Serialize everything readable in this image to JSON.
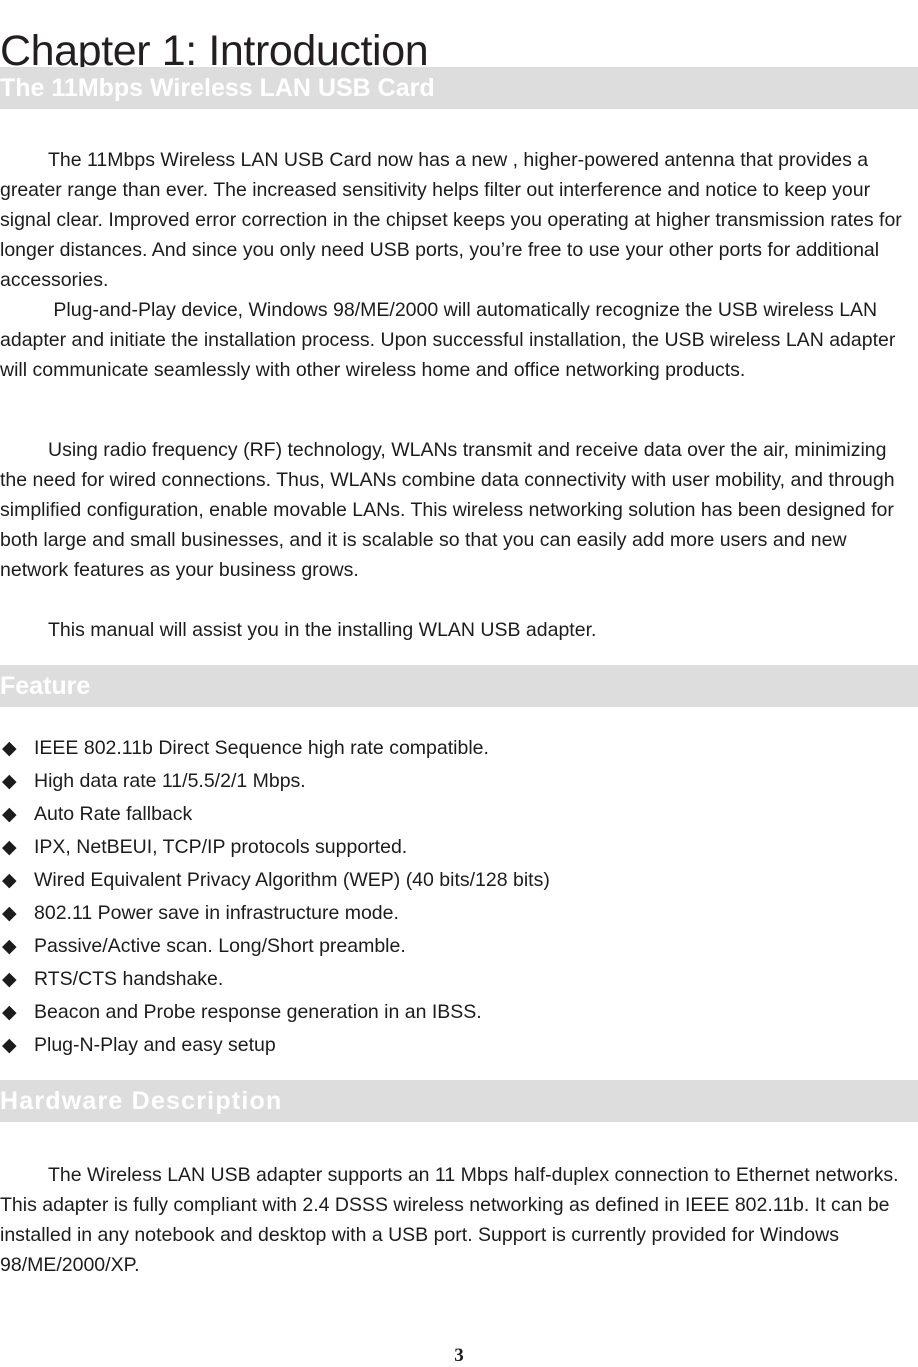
{
  "document": {
    "chapter_title": "Chapter 1: Introduction",
    "page_number": "3",
    "band_color": "#dddddd",
    "band_text_color": "#ffffff",
    "body_text_color": "#1c1c1c"
  },
  "sections": {
    "card": {
      "heading": "The 11Mbps Wireless LAN USB Card",
      "paragraphs": [
        "The 11Mbps Wireless LAN USB Card now has a new , higher-powered antenna that provides a greater range than ever. The increased sensitivity helps filter out interference and notice to keep your signal clear. Improved error correction in the chipset keeps you operating at higher transmission rates for longer distances. And since you only need USB ports, you’re free to use your other ports for additional accessories.",
        " Plug-and-Play device, Windows 98/ME/2000 will automatically recognize the USB wireless LAN adapter and initiate the installation process. Upon successful installation, the USB wireless LAN adapter  will communicate seamlessly with other  wireless home and office networking products.",
        "Using radio frequency (RF) technology, WLANs transmit and receive data over the air, minimizing the need for wired connections. Thus, WLANs combine data connectivity with user mobility, and through simplified configuration, enable movable LANs. This wireless networking solution has been designed for both large and small businesses, and it is scalable so that you can easily add more users and new network features as your business grows.",
        "This manual will assist you in the installing WLAN USB adapter."
      ]
    },
    "feature": {
      "heading": "Feature",
      "bullet_glyph": "◆",
      "items": [
        " IEEE 802.11b Direct Sequence high rate compatible.",
        "High data rate 11/5.5/2/1 Mbps.",
        "Auto Rate fallback",
        "IPX, NetBEUI, TCP/IP protocols supported.",
        "Wired Equivalent Privacy Algorithm (WEP) (40 bits/128 bits)",
        "802.11 Power save in infrastructure mode.",
        "Passive/Active scan. Long/Short preamble.",
        "RTS/CTS handshake.",
        "Beacon and Probe response generation in an IBSS.",
        "Plug-N-Play and easy setup"
      ]
    },
    "hardware": {
      "heading": "Hardware Description",
      "paragraphs": [
        "The Wireless LAN USB adapter supports an 11 Mbps half-duplex connection to Ethernet networks. This adapter is fully compliant with 2.4 DSSS wireless networking as defined in IEEE 802.11b. It can be installed in any notebook and desktop with a USB port. Support is currently provided for Windows 98/ME/2000/XP."
      ]
    }
  }
}
